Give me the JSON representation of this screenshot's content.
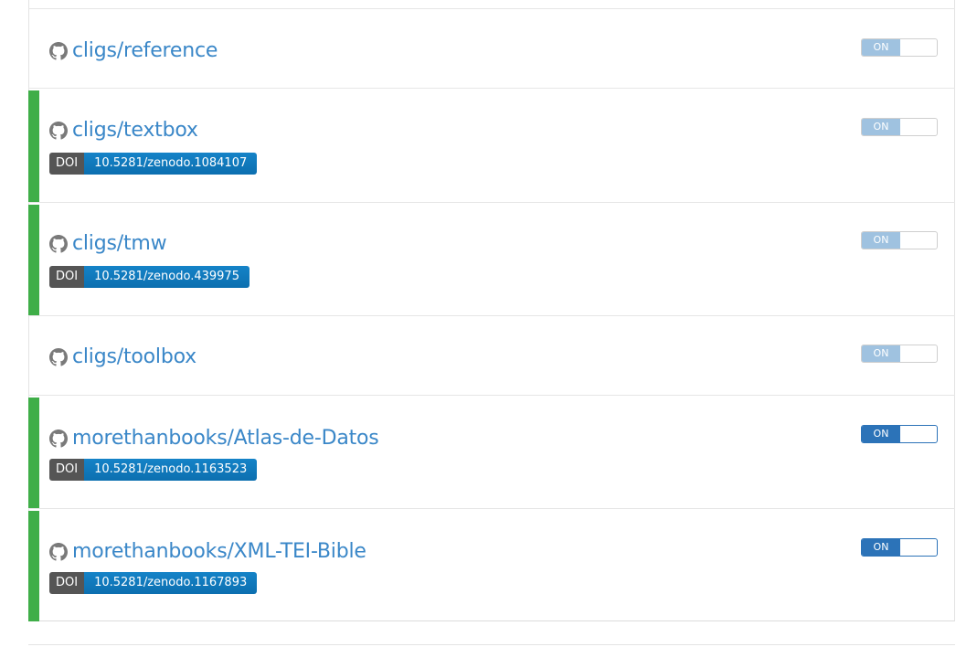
{
  "repositories": [
    {
      "name": "cligs/reference",
      "doi": null,
      "toggle_label": "ON",
      "toggle_state": "faded",
      "enabled": false
    },
    {
      "name": "cligs/textbox",
      "doi": {
        "label": "DOI",
        "value": "10.5281/zenodo.1084107"
      },
      "toggle_label": "ON",
      "toggle_state": "faded",
      "enabled": true
    },
    {
      "name": "cligs/tmw",
      "doi": {
        "label": "DOI",
        "value": "10.5281/zenodo.439975"
      },
      "toggle_label": "ON",
      "toggle_state": "faded",
      "enabled": true
    },
    {
      "name": "cligs/toolbox",
      "doi": null,
      "toggle_label": "ON",
      "toggle_state": "faded",
      "enabled": false
    },
    {
      "name": "morethanbooks/Atlas-de-Datos",
      "doi": {
        "label": "DOI",
        "value": "10.5281/zenodo.1163523"
      },
      "toggle_label": "ON",
      "toggle_state": "active",
      "enabled": true
    },
    {
      "name": "morethanbooks/XML-TEI-Bible",
      "doi": {
        "label": "DOI",
        "value": "10.5281/zenodo.1167893"
      },
      "toggle_label": "ON",
      "toggle_state": "active",
      "enabled": true
    }
  ],
  "colors": {
    "link": "#3a87c8",
    "enabled_bar": "#3fae48",
    "toggle_active": "#2c73b8",
    "toggle_faded": "#9fc2e0",
    "doi_label_bg": "#555555",
    "doi_value_bg": "#0c6fb0"
  },
  "icons": {
    "repo": "github-icon"
  }
}
